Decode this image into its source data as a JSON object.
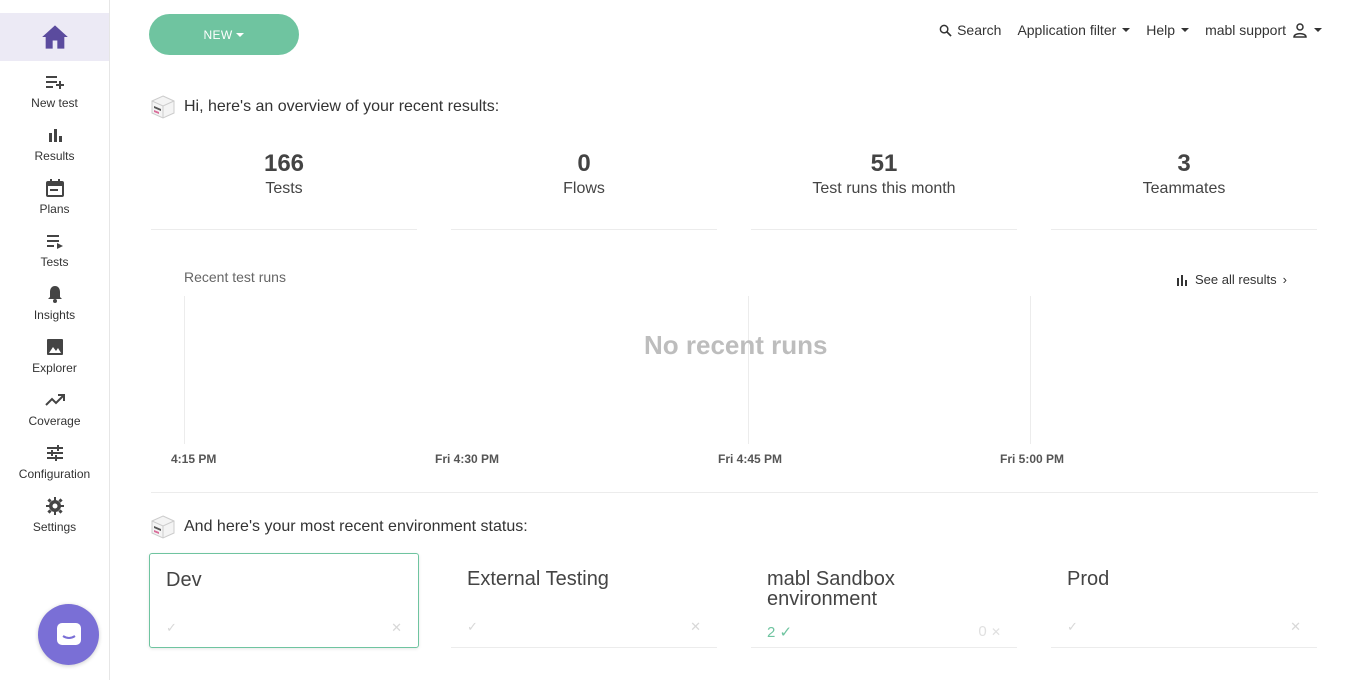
{
  "sidebar": {
    "home_icon": "home-icon",
    "items": [
      {
        "label": "New test",
        "icon": "playlist-add-icon"
      },
      {
        "label": "Results",
        "icon": "bar-chart-icon"
      },
      {
        "label": "Plans",
        "icon": "calendar-icon"
      },
      {
        "label": "Tests",
        "icon": "playlist-play-icon"
      },
      {
        "label": "Insights",
        "icon": "bell-icon"
      },
      {
        "label": "Explorer",
        "icon": "image-icon"
      },
      {
        "label": "Coverage",
        "icon": "trending-up-icon"
      },
      {
        "label": "Configuration",
        "icon": "sliders-icon"
      },
      {
        "label": "Settings",
        "icon": "gear-icon"
      }
    ]
  },
  "header": {
    "new_button": "NEW",
    "search": "Search",
    "app_filter": "Application filter",
    "help": "Help",
    "user": "mabl support"
  },
  "overview": {
    "greeting": "Hi, here's an overview of your recent results:",
    "stats": [
      {
        "value": "166",
        "label": "Tests"
      },
      {
        "value": "0",
        "label": "Flows"
      },
      {
        "value": "51",
        "label": "Test runs this month"
      },
      {
        "value": "3",
        "label": "Teammates"
      }
    ]
  },
  "chart_data": {
    "type": "bar",
    "title": "Recent test runs",
    "empty_message": "No recent runs",
    "categories": [
      "4:15 PM",
      "Fri 4:30 PM",
      "Fri 4:45 PM",
      "Fri 5:00 PM"
    ],
    "values": [],
    "see_all": "See all results"
  },
  "environments": {
    "heading": "And here's your most recent environment status:",
    "cards": [
      {
        "name": "Dev",
        "passed": "",
        "failed": ""
      },
      {
        "name": "External Testing",
        "passed": "",
        "failed": ""
      },
      {
        "name": "mabl Sandbox environment",
        "passed": "2",
        "failed": "0"
      },
      {
        "name": "Prod",
        "passed": "",
        "failed": ""
      }
    ]
  },
  "colors": {
    "accent": "#6fc4a0",
    "sidebar_active": "#eceaf5",
    "brand_purple": "#5b4b9e",
    "chat": "#7a6fd6"
  }
}
